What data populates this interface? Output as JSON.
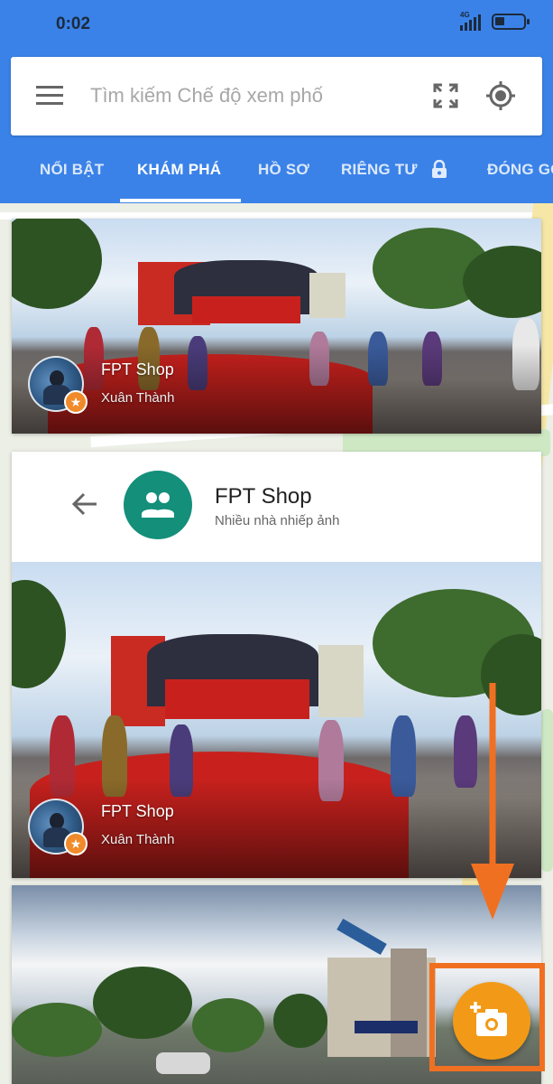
{
  "status_bar": {
    "time": "0:02",
    "network": "4G"
  },
  "search": {
    "placeholder": "Tìm kiếm Chế độ xem phố"
  },
  "tabs": [
    {
      "label": "NỔI BẬT",
      "active": false
    },
    {
      "label": "KHÁM PHÁ",
      "active": true
    },
    {
      "label": "HỒ SƠ",
      "active": false
    },
    {
      "label": "RIÊNG TƯ",
      "active": false
    },
    {
      "label": "ĐÓNG GÓ",
      "active": false
    }
  ],
  "card1": {
    "title": "FPT Shop",
    "author": "Xuân Thành"
  },
  "detail": {
    "title": "FPT Shop",
    "subtitle": "Nhiều nhà nhiếp ảnh",
    "photo_title": "FPT Shop",
    "photo_author": "Xuân Thành"
  },
  "colors": {
    "header_blue": "#3a82e8",
    "fab_orange": "#f29a17",
    "annotation_orange": "#f07022",
    "group_avatar_teal": "#138f7a"
  },
  "icons": {
    "menu": "menu-icon",
    "expand": "fullscreen-icon",
    "locate": "my-location-icon",
    "lock": "lock-icon",
    "back": "back-arrow-icon",
    "group": "people-icon",
    "add_photo": "add-photo-icon",
    "badge": "star-badge-icon"
  }
}
